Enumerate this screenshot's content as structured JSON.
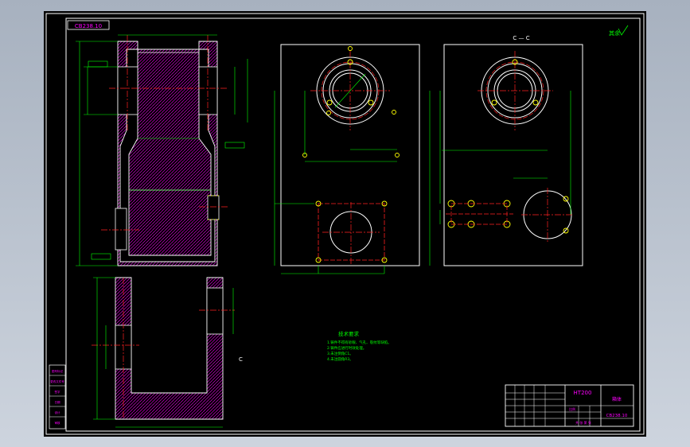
{
  "drawing": {
    "code_box": "CB238.10",
    "section_label": "C — C",
    "section_mark": "C",
    "roughness_note": "其余",
    "tech_req_title": "技术要求",
    "tech_req_lines": [
      "1.铸件不得有砂眼、气孔、裂纹等缺陷。",
      "2.铸件应进行时效处理。",
      "3.未注倒角C1。",
      "4.未注圆角R3。"
    ],
    "left_labels": [
      "图号标记",
      "更改文件号",
      "签字",
      "日期",
      "设计",
      "审核"
    ],
    "title_block": {
      "material": "HT200",
      "part_name": "箱体",
      "drawing_no": "CB238.10",
      "scale_label": "比例",
      "sheet_label": "共 张 第 张"
    }
  },
  "colors": {
    "sheet": "#000000",
    "frame": "#ffffff",
    "part": "#ffffff",
    "dimension": "#00ff00",
    "center": "#ff2020",
    "hatch": "#ff00ff",
    "hidden": "#ffff00",
    "label": "#00ffff"
  }
}
